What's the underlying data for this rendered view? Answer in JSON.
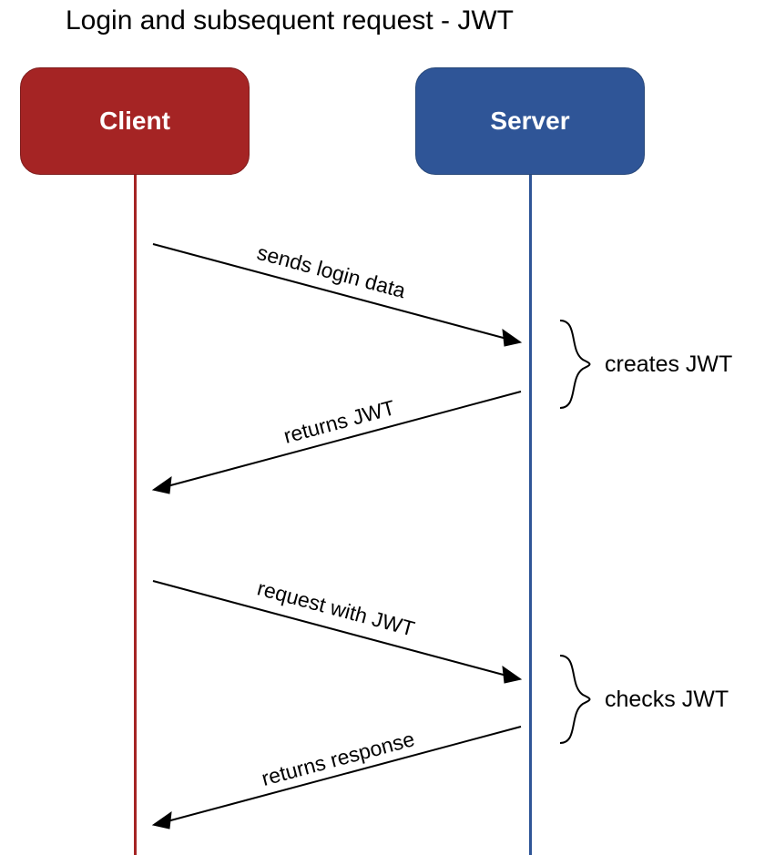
{
  "title": "Login and subsequent request - JWT",
  "actors": {
    "client": "Client",
    "server": "Server"
  },
  "messages": {
    "m1": "sends login data",
    "m2": "returns JWT",
    "m3": "request with JWT",
    "m4": "returns response"
  },
  "notes": {
    "n1": "creates JWT",
    "n2": "checks JWT"
  }
}
